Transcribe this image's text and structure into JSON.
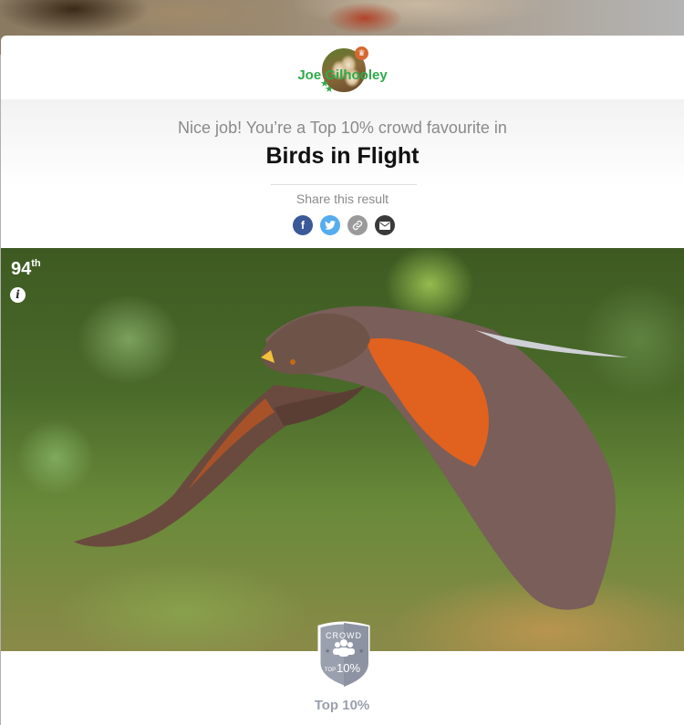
{
  "user": {
    "name": "Joe Gilhooley",
    "avatar_alt": "barn owls avatar",
    "crown_icon": "crown-icon",
    "stars_icon": "stars-icon"
  },
  "result": {
    "headline": "Nice job! You’re a Top 10% crowd favourite in",
    "category": "Birds in Flight"
  },
  "share": {
    "label": "Share this result",
    "buttons": [
      {
        "name": "facebook",
        "glyph": "f",
        "color": "#3b5998"
      },
      {
        "name": "twitter",
        "glyph": "t",
        "color": "#55acee"
      },
      {
        "name": "copy-link",
        "glyph": "link",
        "color": "#9a9a9a"
      },
      {
        "name": "email",
        "glyph": "envelope",
        "color": "#3a3a3a"
      }
    ]
  },
  "photo": {
    "subject": "Harris's hawk in flight",
    "rank_number": "94",
    "rank_suffix": "th",
    "info_glyph": "i"
  },
  "badge": {
    "top_text": "CROWD",
    "small_text": "TOP",
    "big_text": "10%",
    "label": "Top 10%"
  },
  "colors": {
    "username": "#2eaa4a",
    "crown": "#d5692f",
    "badge": "#9aa0ad"
  }
}
